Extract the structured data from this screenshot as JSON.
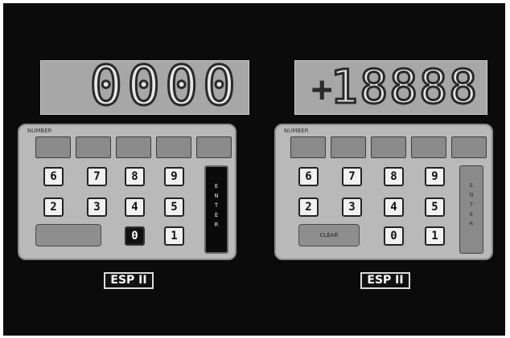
{
  "left_unit": {
    "display": "0000",
    "panel_label": "NUMBER",
    "function_keys": [
      "",
      "",
      "",
      "",
      ""
    ],
    "number_keys": [
      "6",
      "7",
      "8",
      "9",
      "2",
      "3",
      "4",
      "5",
      "0",
      "1"
    ],
    "clear_label": "",
    "enter_label": "ENTER",
    "brand": "ESP II"
  },
  "right_unit": {
    "sign": "+",
    "display": "18888",
    "panel_label": "NUMBER",
    "function_keys": [
      "",
      "",
      "",
      "",
      ""
    ],
    "number_keys": [
      "6",
      "7",
      "8",
      "9",
      "2",
      "3",
      "4",
      "5",
      "0",
      "1"
    ],
    "clear_label": "CLEAR",
    "enter_label": "ENTER",
    "brand": "ESP II"
  }
}
